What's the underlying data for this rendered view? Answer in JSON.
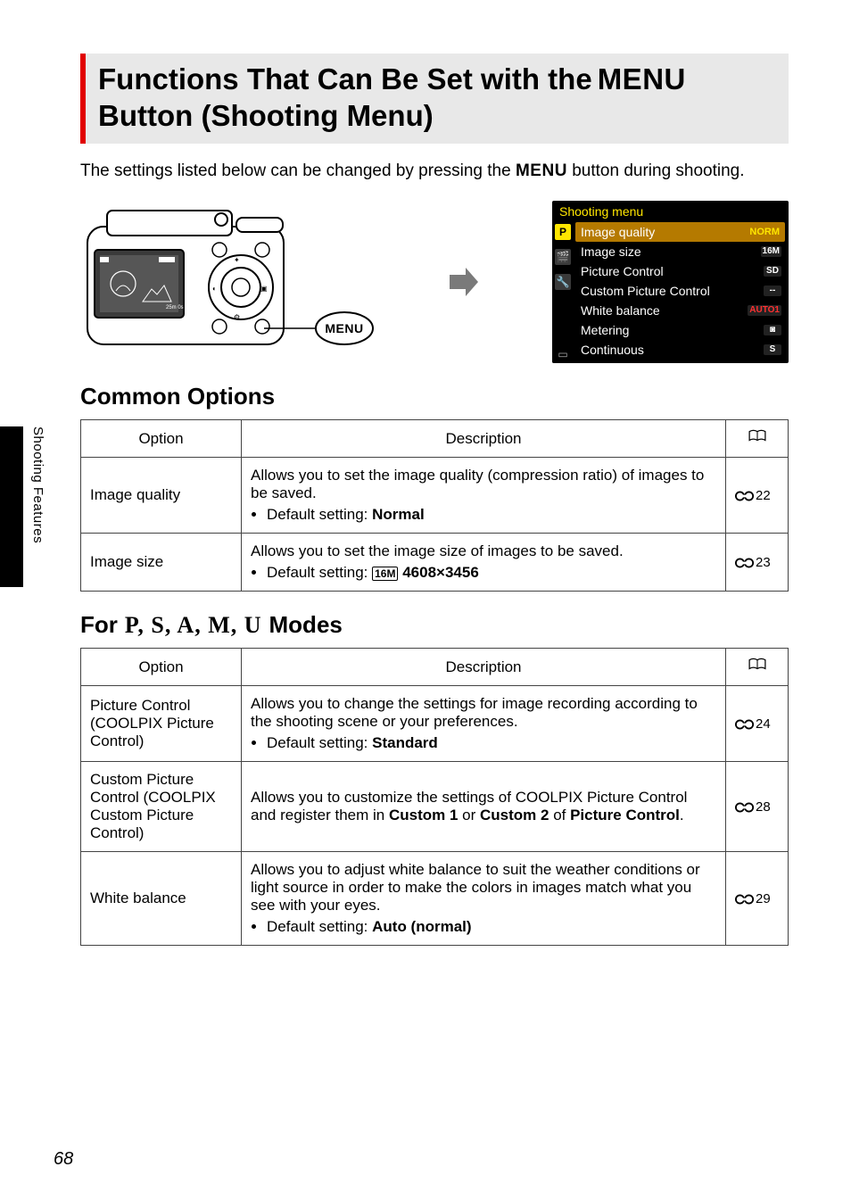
{
  "title_top_prefix": "Functions That Can Be Set with the",
  "title_top_menu": "MENU",
  "title_bottom": "Button (Shooting Menu)",
  "intro_prefix": "The settings listed below can be changed by pressing the ",
  "intro_menu": "MENU",
  "intro_suffix": " button during shooting.",
  "camera_menu_button": "MENU",
  "shooting_menu": {
    "title": "Shooting menu",
    "tabs": [
      "P",
      "🎬",
      "🔧"
    ],
    "rows": [
      {
        "label": "Image quality",
        "value": "NORM",
        "selected": true
      },
      {
        "label": "Image size",
        "value": "16M"
      },
      {
        "label": "Picture Control",
        "value": "SD"
      },
      {
        "label": "Custom Picture Control",
        "value": "--"
      },
      {
        "label": "White balance",
        "value": "AUTO1"
      },
      {
        "label": "Metering",
        "value": "◙"
      },
      {
        "label": "Continuous",
        "value": "S"
      }
    ],
    "battery_glyph": "▭"
  },
  "section_common": "Common Options",
  "table_common": {
    "headers": {
      "option": "Option",
      "description": "Description"
    },
    "rows": [
      {
        "option": "Image quality",
        "desc": "Allows you to set the image quality (compression ratio) of images to be saved.",
        "bullet_prefix": "Default setting: ",
        "bullet_bold": "Normal",
        "ref": "22"
      },
      {
        "option": "Image size",
        "desc": "Allows you to set the image size of images to be saved.",
        "bullet_prefix": "Default setting: ",
        "bullet_icon": "16M",
        "bullet_bold": "4608×3456",
        "ref": "23"
      }
    ]
  },
  "section_modes_prefix": "For ",
  "section_modes_letters": "P, S, A, M, U",
  "section_modes_suffix": " Modes",
  "table_modes": {
    "headers": {
      "option": "Option",
      "description": "Description"
    },
    "rows": [
      {
        "option": "Picture Control (COOLPIX Picture Control)",
        "desc": "Allows you to change the settings for image recording according to the shooting scene or your preferences.",
        "bullet_prefix": "Default setting: ",
        "bullet_bold": "Standard",
        "ref": "24"
      },
      {
        "option": "Custom Picture Control (COOLPIX Custom Picture Control)",
        "desc_parts": {
          "p1": "Allows you to customize the settings of COOLPIX Picture Control and register them in ",
          "b1": "Custom 1",
          "p2": " or ",
          "b2": "Custom 2",
          "p3": " of ",
          "b3": "Picture Control",
          "p4": "."
        },
        "ref": "28"
      },
      {
        "option": "White balance",
        "desc": "Allows you to adjust white balance to suit the weather conditions or light source in order to make the colors in images match what you see with your eyes.",
        "bullet_prefix": "Default setting: ",
        "bullet_bold": "Auto (normal)",
        "ref": "29"
      }
    ]
  },
  "side_label": "Shooting Features",
  "page_number": "68"
}
